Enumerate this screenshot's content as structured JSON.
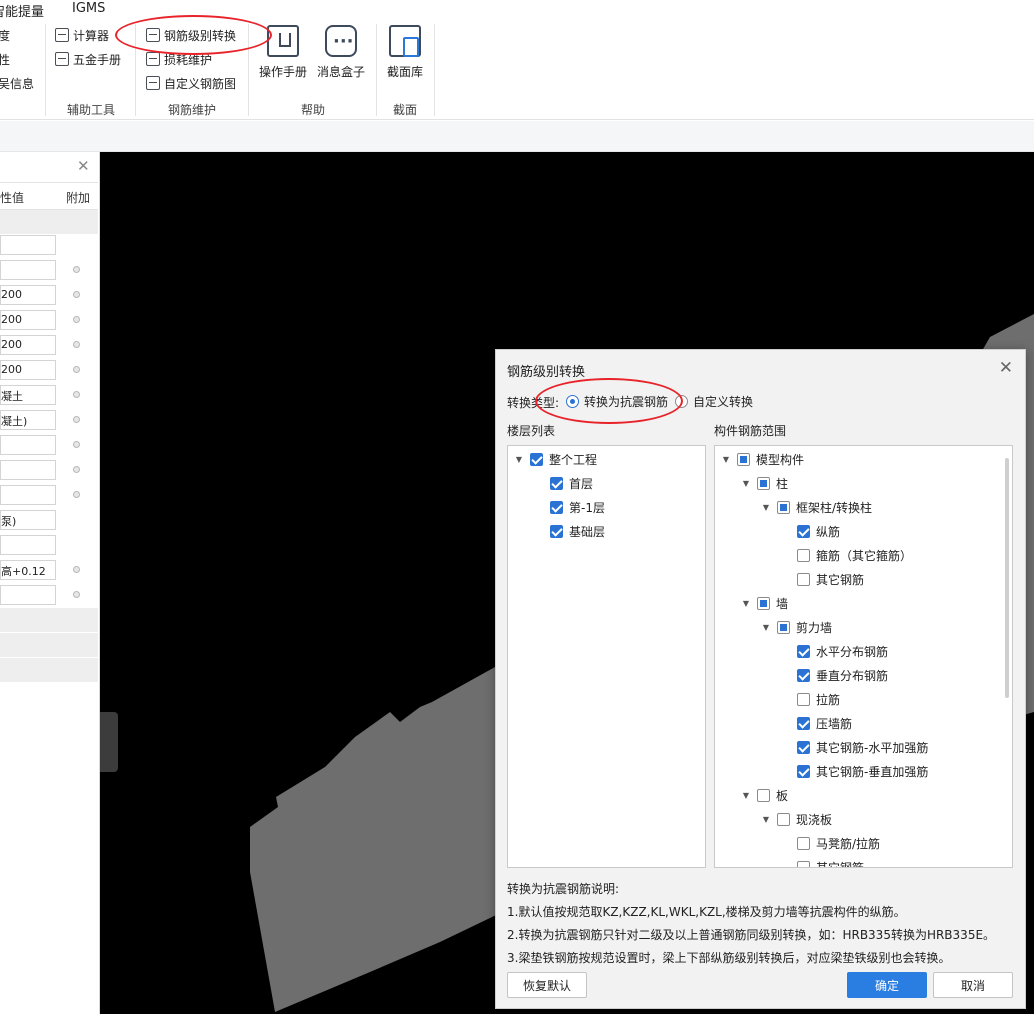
{
  "menubar": {
    "item1": "智能提量",
    "item2": "IGMS"
  },
  "ribbon": {
    "left_cut": [
      "度",
      "性",
      "吴信息"
    ],
    "aux": {
      "calculator": "计算器",
      "hardware_manual": "五金手册",
      "label": "辅助工具"
    },
    "rebar": {
      "grade_convert": "钢筋级别转换",
      "loss_maint": "损耗维护",
      "custom_rebar": "自定义钢筋图",
      "label": "钢筋维护"
    },
    "help": {
      "manual": "操作手册",
      "msgbox": "消息盒子",
      "label": "帮助"
    },
    "section": {
      "lib": "截面库",
      "label": "截面"
    }
  },
  "left_panel": {
    "col_value": "性值",
    "col_extra": "附加",
    "rows": [
      "",
      "",
      "200",
      "200",
      "200",
      "200",
      "凝土",
      "凝土)",
      "",
      "",
      "",
      "泵)",
      "",
      "高+0.12",
      ""
    ]
  },
  "dialog": {
    "title": "钢筋级别转换",
    "type_label": "转换类型:",
    "radio_seismic": "转换为抗震钢筋",
    "radio_custom": "自定义转换",
    "floor_list_label": "楼层列表",
    "range_label": "构件钢筋范围",
    "floors": [
      "整个工程",
      "首层",
      "第-1层",
      "基础层"
    ],
    "range_tree": [
      "模型构件",
      "柱",
      "框架柱/转换柱",
      "纵筋",
      "箍筋（其它箍筋）",
      "其它钢筋",
      "墙",
      "剪力墙",
      "水平分布钢筋",
      "垂直分布钢筋",
      "拉筋",
      "压墙筋",
      "其它钢筋-水平加强筋",
      "其它钢筋-垂直加强筋",
      "板",
      "现浇板",
      "马凳筋/拉筋",
      "其它钢筋"
    ],
    "notes": {
      "title": "转换为抗震钢筋说明:",
      "l1": "1.默认值按规范取KZ,KZZ,KL,WKL,KZL,楼梯及剪力墙等抗震构件的纵筋。",
      "l2": "2.转换为抗震钢筋只针对二级及以上普通钢筋同级别转换，如：HRB335转换为HRB335E。",
      "l3": "3.梁垫铁钢筋按规范设置时，梁上下部纵筋级别转换后，对应梁垫铁级别也会转换。"
    },
    "btn_reset": "恢复默认",
    "btn_ok": "确定",
    "btn_cancel": "取消"
  },
  "colors": {
    "accent": "#2a7de1",
    "annotation": "#e8232a",
    "viewport": "#000000",
    "model": "#6e6e6e"
  }
}
